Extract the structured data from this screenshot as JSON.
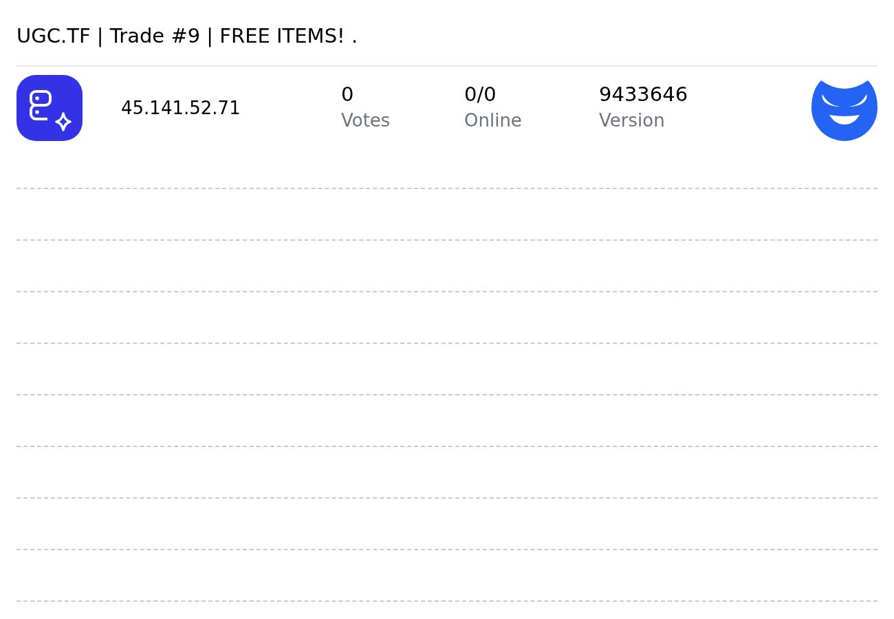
{
  "title": "UGC.TF | Trade #9 | FREE ITEMS! .",
  "server": {
    "address": "45.141.52.71",
    "stats": [
      {
        "value": "0",
        "label": "Votes"
      },
      {
        "value": "0/0",
        "label": "Online"
      },
      {
        "value": "9433646",
        "label": "Version"
      }
    ]
  }
}
